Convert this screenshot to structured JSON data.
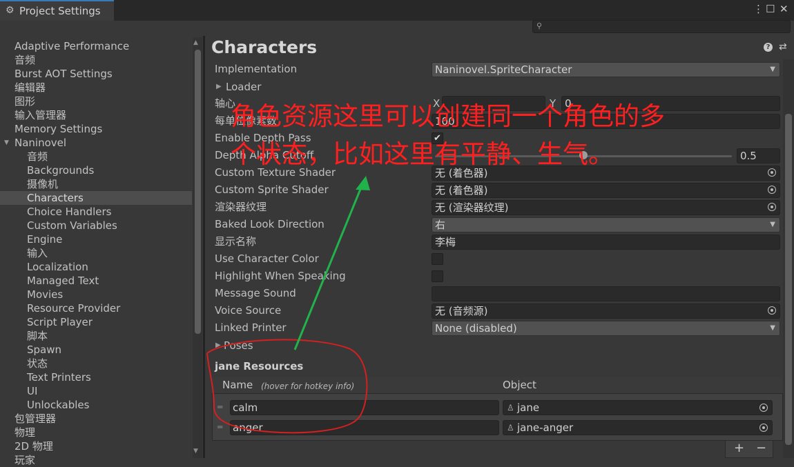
{
  "window": {
    "tab_title": "Project Settings",
    "tab_icon": "gear-icon"
  },
  "sidebar": {
    "items": [
      {
        "label": "Adaptive Performance",
        "indent": 0
      },
      {
        "label": "音频",
        "indent": 0
      },
      {
        "label": "Burst AOT Settings",
        "indent": 0
      },
      {
        "label": "编辑器",
        "indent": 0
      },
      {
        "label": "图形",
        "indent": 0
      },
      {
        "label": "输入管理器",
        "indent": 0
      },
      {
        "label": "Memory Settings",
        "indent": 0
      },
      {
        "label": "Naninovel",
        "indent": 0,
        "expanded": true
      },
      {
        "label": "音频",
        "indent": 1
      },
      {
        "label": "Backgrounds",
        "indent": 1
      },
      {
        "label": "摄像机",
        "indent": 1
      },
      {
        "label": "Characters",
        "indent": 1,
        "selected": true
      },
      {
        "label": "Choice Handlers",
        "indent": 1
      },
      {
        "label": "Custom Variables",
        "indent": 1
      },
      {
        "label": "Engine",
        "indent": 1
      },
      {
        "label": "输入",
        "indent": 1
      },
      {
        "label": "Localization",
        "indent": 1
      },
      {
        "label": "Managed Text",
        "indent": 1
      },
      {
        "label": "Movies",
        "indent": 1
      },
      {
        "label": "Resource Provider",
        "indent": 1
      },
      {
        "label": "Script Player",
        "indent": 1
      },
      {
        "label": "脚本",
        "indent": 1
      },
      {
        "label": "Spawn",
        "indent": 1
      },
      {
        "label": "状态",
        "indent": 1
      },
      {
        "label": "Text Printers",
        "indent": 1
      },
      {
        "label": "UI",
        "indent": 1
      },
      {
        "label": "Unlockables",
        "indent": 1
      },
      {
        "label": "包管理器",
        "indent": 0
      },
      {
        "label": "物理",
        "indent": 0
      },
      {
        "label": "2D 物理",
        "indent": 0
      },
      {
        "label": "玩家",
        "indent": 0
      }
    ]
  },
  "main": {
    "heading": "Characters",
    "implementation": {
      "label": "Implementation",
      "value": "Naninovel.SpriteCharacter"
    },
    "loader": {
      "label": "Loader"
    },
    "pivot": {
      "label": "轴心",
      "x_label": "X",
      "x_value": "",
      "y_label": "Y",
      "y_value": "0"
    },
    "ppu": {
      "label": "每单位像素数",
      "value": "100"
    },
    "depth_pass": {
      "label": "Enable Depth Pass",
      "checked": true
    },
    "alpha_cutoff": {
      "label": "Depth Alpha Cutoff",
      "value": "0.5",
      "level": 0.5
    },
    "texture_shader": {
      "label": "Custom Texture Shader",
      "value": "无 (着色器)"
    },
    "sprite_shader": {
      "label": "Custom Sprite Shader",
      "value": "无 (着色器)"
    },
    "render_texture": {
      "label": "渲染器纹理",
      "value": "无 (渲染器纹理)"
    },
    "look_direction": {
      "label": "Baked Look Direction",
      "value": "右"
    },
    "display_name": {
      "label": "显示名称",
      "value": "李梅"
    },
    "use_color": {
      "label": "Use Character Color",
      "checked": false
    },
    "highlight": {
      "label": "Highlight When Speaking",
      "checked": false
    },
    "message_sound": {
      "label": "Message Sound",
      "value": ""
    },
    "voice_source": {
      "label": "Voice Source",
      "value": "无 (音频源)"
    },
    "linked_printer": {
      "label": "Linked Printer",
      "value": "None (disabled)"
    },
    "poses": {
      "label": "Poses"
    }
  },
  "resources": {
    "title": "jane Resources",
    "col_name": "Name",
    "col_hint": "(hover for hotkey info)",
    "col_object": "Object",
    "rows": [
      {
        "name": "calm",
        "object": "jane"
      },
      {
        "name": "anger",
        "object": "jane-anger"
      }
    ],
    "add_label": "+",
    "remove_label": "−"
  },
  "annotation": {
    "line1": "角色资源这里可以创建同一个角色的多",
    "line2": "个状态，比如这里有平静、生气。",
    "text_color": "#ff1f1f",
    "arrow_color": "#22b24c",
    "circle_color": "#d42020"
  }
}
